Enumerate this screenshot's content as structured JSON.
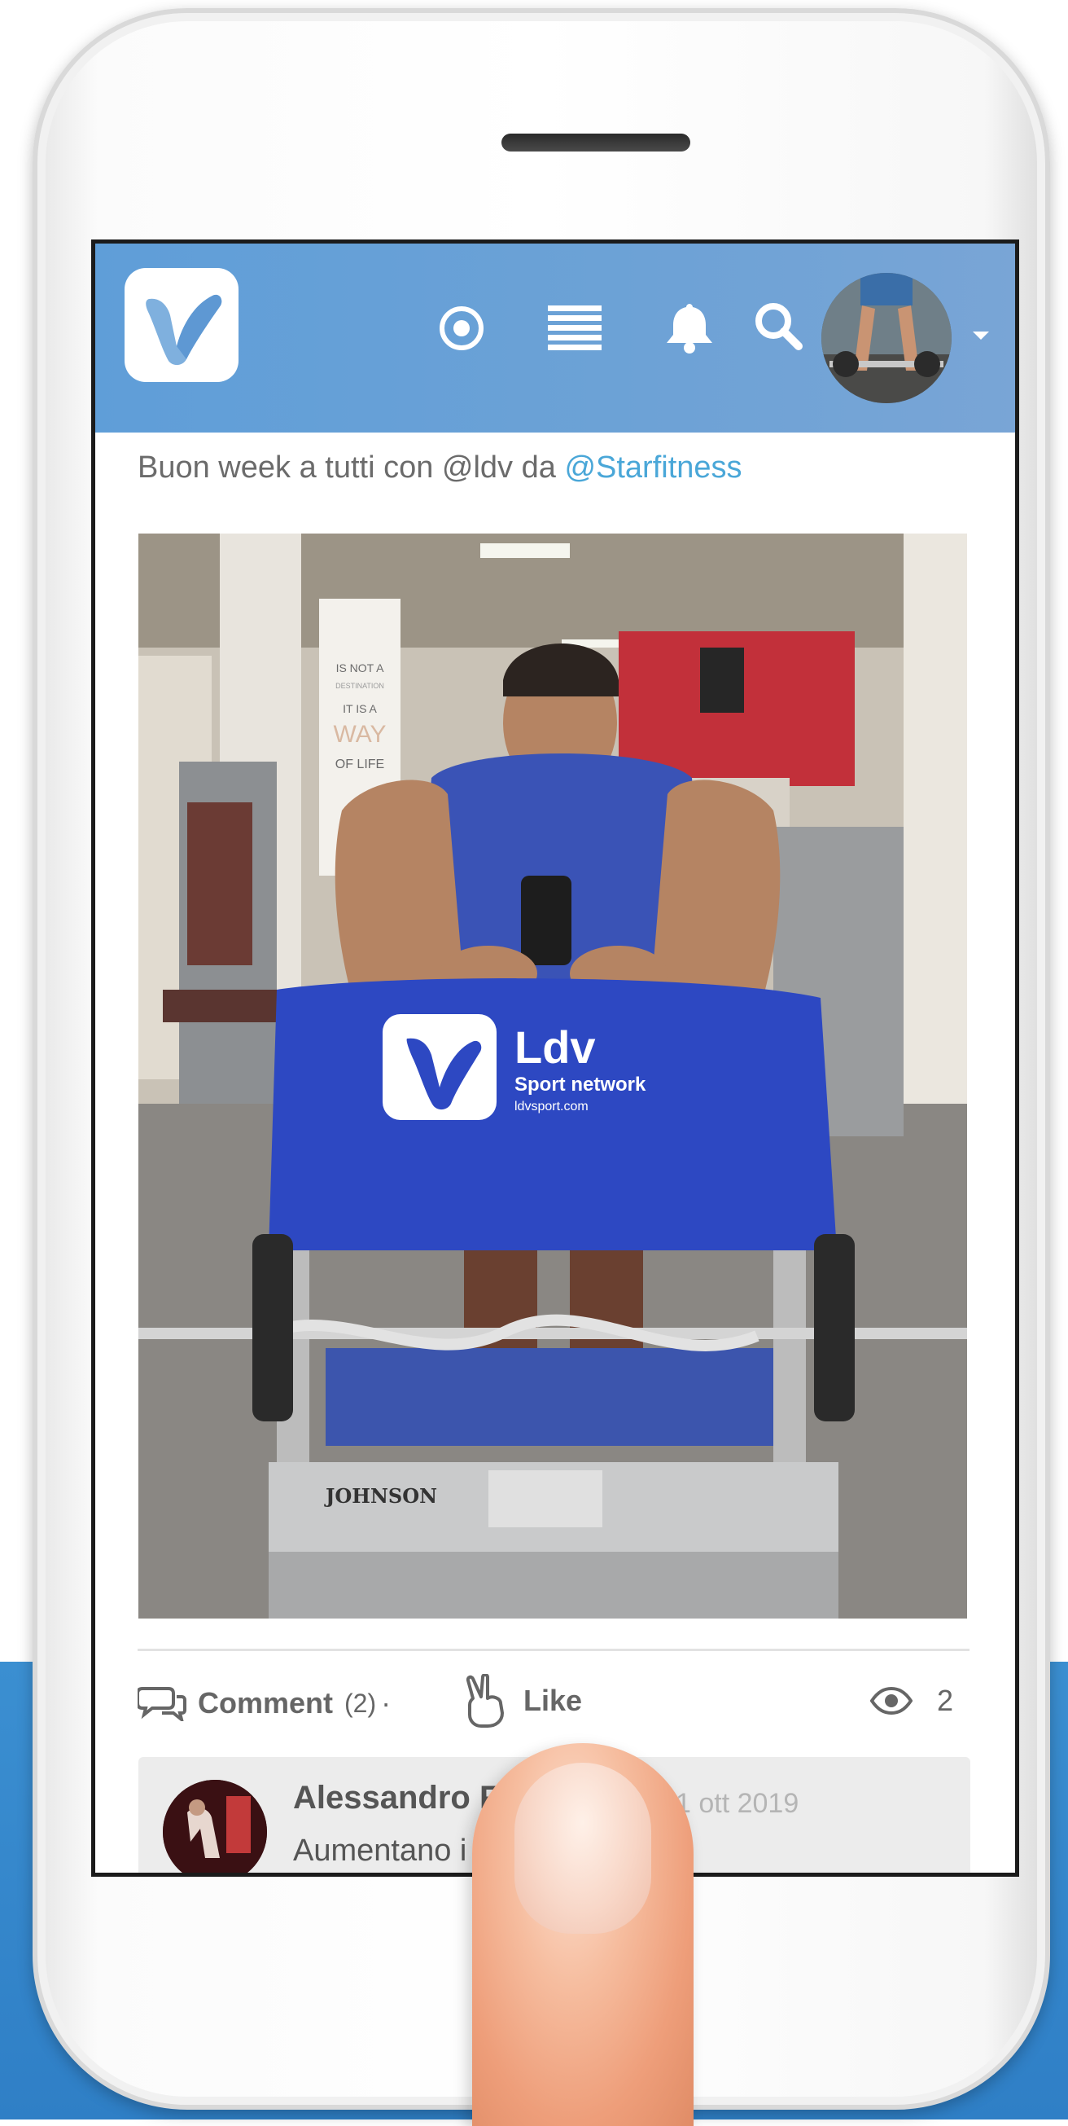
{
  "app": {
    "logo_icon": "ldv-logo-icon",
    "header_icons": [
      "target-icon",
      "menu-icon",
      "bell-icon",
      "search-icon"
    ],
    "accent_color": "#6aa1d8",
    "mention_color": "#4aa7d8"
  },
  "post": {
    "text_prefix": "Buon week a tutti con @ldv da ",
    "mention": "@Starfitness",
    "image": {
      "poster_text": [
        "IS NOT A",
        "DESTINATION",
        "IT IS A",
        "WAY",
        "OF LIFE"
      ],
      "towel_brand": "Ldv",
      "towel_tagline": "Sport network",
      "towel_url": "ldvsport.com",
      "machine_brand": "JOHNSON"
    },
    "actions": {
      "comment_label": "Comment",
      "comment_count": "(2)",
      "separator": "·",
      "like_label": "Like",
      "views_count": "2"
    }
  },
  "comment": {
    "author": "Alessandro F",
    "date": "1 ott 2019",
    "text": "Aumentano i"
  }
}
